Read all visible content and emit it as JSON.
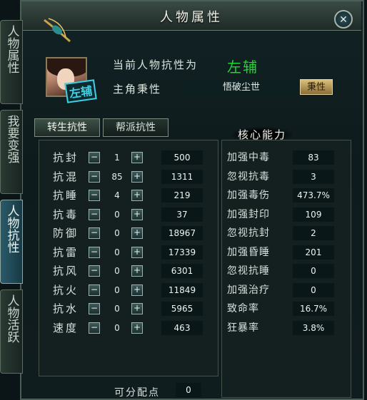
{
  "window": {
    "title": "人物属性"
  },
  "side_tabs": [
    {
      "label": "人物属性",
      "active": false
    },
    {
      "label": "我要变强",
      "active": false
    },
    {
      "label": "人物抗性",
      "active": true
    },
    {
      "label": "人物活跃",
      "active": false
    }
  ],
  "character": {
    "resist_label": "当前人物抗性为",
    "role": "左辅",
    "role_stamp": "左辅",
    "attr_label": "主角秉性",
    "attr_value": "悟破尘世",
    "attr_button": "秉性"
  },
  "tabs": [
    {
      "label": "转生抗性",
      "active": true
    },
    {
      "label": "帮派抗性",
      "active": false
    }
  ],
  "core_title": "核心能力",
  "resistances": [
    {
      "label": "抗封",
      "points": "1",
      "value": "500"
    },
    {
      "label": "抗混",
      "points": "85",
      "value": "1311"
    },
    {
      "label": "抗睡",
      "points": "4",
      "value": "219"
    },
    {
      "label": "抗毒",
      "points": "0",
      "value": "37"
    },
    {
      "label": "防御",
      "points": "0",
      "value": "18967"
    },
    {
      "label": "抗雷",
      "points": "0",
      "value": "17339"
    },
    {
      "label": "抗风",
      "points": "0",
      "value": "6301"
    },
    {
      "label": "抗火",
      "points": "0",
      "value": "11849"
    },
    {
      "label": "抗水",
      "points": "0",
      "value": "5965"
    },
    {
      "label": "速度",
      "points": "0",
      "value": "463"
    }
  ],
  "core_stats": [
    {
      "label": "加强中毒",
      "value": "83"
    },
    {
      "label": "忽视抗毒",
      "value": "3"
    },
    {
      "label": "加强毒伤",
      "value": "473.7%"
    },
    {
      "label": "加强封印",
      "value": "109"
    },
    {
      "label": "忽视抗封",
      "value": "2"
    },
    {
      "label": "加强昏睡",
      "value": "201"
    },
    {
      "label": "忽视抗睡",
      "value": "0"
    },
    {
      "label": "加强治疗",
      "value": "0"
    },
    {
      "label": "致命率",
      "value": "16.7%"
    },
    {
      "label": "狂暴率",
      "value": "3.8%"
    }
  ],
  "free_points": {
    "label": "可分配点",
    "value": "0"
  },
  "icons": {
    "minus": "−",
    "plus": "+",
    "close": "✕"
  }
}
